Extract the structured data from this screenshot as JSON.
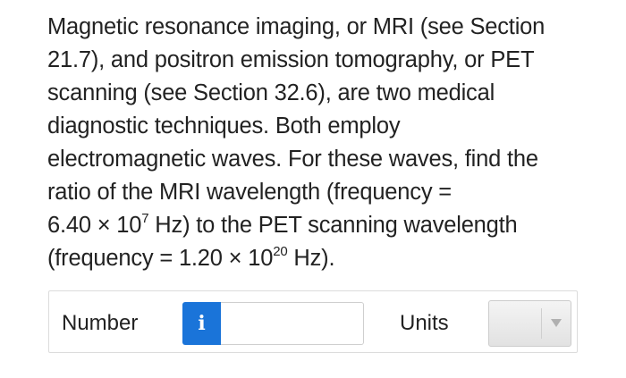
{
  "question": {
    "lines": [
      "Magnetic resonance imaging, or MRI (see Section",
      "21.7), and positron emission tomography, or PET",
      "scanning (see Section 32.6), are two medical",
      "diagnostic techniques. Both employ",
      "electromagnetic waves. For these waves, find the",
      "ratio of the MRI wavelength (frequency ="
    ],
    "line7_base": "6.40 × 10",
    "line7_exp": "7",
    "line7_rest": " Hz) to the PET scanning wavelength",
    "line8_base": "(frequency = 1.20 × 10",
    "line8_exp": "20",
    "line8_rest": " Hz)."
  },
  "answer": {
    "number_label": "Number",
    "info_icon": "i",
    "number_value": "",
    "units_label": "Units",
    "units_selected": ""
  },
  "colors": {
    "info_button": "#1a74d9",
    "text": "#222222"
  },
  "icons": {
    "info": "info-icon",
    "dropdown": "chevron-down-icon"
  }
}
